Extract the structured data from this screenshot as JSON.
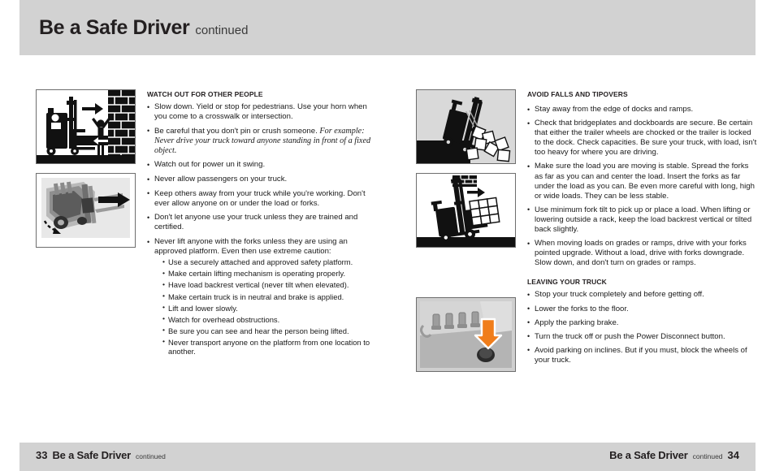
{
  "header": {
    "title": "Be a Safe Driver",
    "continued": "continued"
  },
  "left_column": {
    "figures": [
      {
        "name": "forklift-pinning-person-against-brick-wall",
        "alt": "Line drawing: stand-up forklift driving toward a person standing in front of a brick wall, arrows showing direction of travel"
      },
      {
        "name": "forklift-photo-with-turn-arrows",
        "alt": "Grayscale photo of a stand-up reach truck with black arrows showing the power unit swinging"
      }
    ],
    "section": {
      "heading": "WATCH OUT FOR OTHER PEOPLE",
      "bullets": [
        {
          "text": "Slow down.  Yield or stop for pedestrians. Use your horn when you come to a crosswalk or intersection."
        },
        {
          "text": "Be careful that you don't pin or crush someone. ",
          "italic": "For example: Never drive your truck toward anyone standing in front of a fixed object."
        },
        {
          "text": "Watch out for power un it swing."
        },
        {
          "text": "Never allow passengers on your truck."
        },
        {
          "text": "Keep others away from your truck while you're working. Don't ever allow anyone on or under the load or forks."
        },
        {
          "text": "Don't let anyone use your truck unless they are trained and certified."
        },
        {
          "text": "Never lift anyone with the forks unless they are using an approved platform.  Even then use extreme caution:",
          "sub": [
            "Use a securely attached and approved safety platform.",
            "Make certain lifting mechanism is operating properly.",
            "Have load backrest vertical (never tilt when elevated).",
            "Make certain truck is in neutral and brake is applied.",
            "Lift and lower slowly.",
            "Watch for overhead obstructions.",
            "Be sure you can see and hear the person being lifted.",
            "Never transport anyone on the platform from one location to another."
          ]
        }
      ]
    }
  },
  "right_column": {
    "figures": [
      {
        "name": "forklift-tipping-off-dock-edge",
        "alt": "Line drawing: forklift tipping over the edge of a dock with boxes falling"
      },
      {
        "name": "forklift-driving-up-ramp-with-load",
        "alt": "Line drawing: forklift on a grade with forks pointed upgrade carrying a stacked load, arrow showing direction"
      },
      {
        "name": "power-disconnect-button-photo",
        "alt": "Grayscale photo of truck controls with an orange arrow pointing at the power disconnect button"
      }
    ],
    "sections": [
      {
        "heading": "AVOID FALLS AND TIPOVERS",
        "bullets": [
          "Stay away from the edge of docks and ramps.",
          "Check that bridgeplates and dockboards are secure.  Be certain that either the trailer wheels are chocked or the trailer is locked to the dock.  Check capacities.  Be sure  your truck, with load, isn't too heavy for where you are driving.",
          "Make sure the load you are moving is stable.  Spread the forks as far as you can and center the load.  Insert the forks as far under the load as you can.  Be even more careful with long, high or wide loads.  They can be less stable.",
          "Use minimum fork tilt to pick up or place a load.  When lifting or lowering outside a rack, keep the load backrest vertical or tilted back slightly.",
          "When moving loads on grades or ramps, drive with your forks pointed upgrade.  Without a load, drive with forks downgrade.  Slow down, and don't turn on grades or ramps."
        ]
      },
      {
        "heading": "LEAVING YOUR TRUCK",
        "bullets": [
          "Stop your truck completely and before getting off.",
          "Lower the forks to the floor.",
          "Apply the parking brake.",
          "Turn the truck off or push the Power Disconnect button.",
          "Avoid parking on inclines.  But if you must, block the wheels of your truck."
        ]
      }
    ]
  },
  "footer": {
    "left_page_number": "33",
    "left_title": "Be a Safe Driver",
    "left_continued": "continued",
    "right_title": "Be a Safe Driver",
    "right_continued": "continued",
    "right_page_number": "34"
  },
  "colors": {
    "band_gray": "#d2d2d2",
    "text": "#1a1a1a",
    "accent_orange": "#f07d1a"
  }
}
